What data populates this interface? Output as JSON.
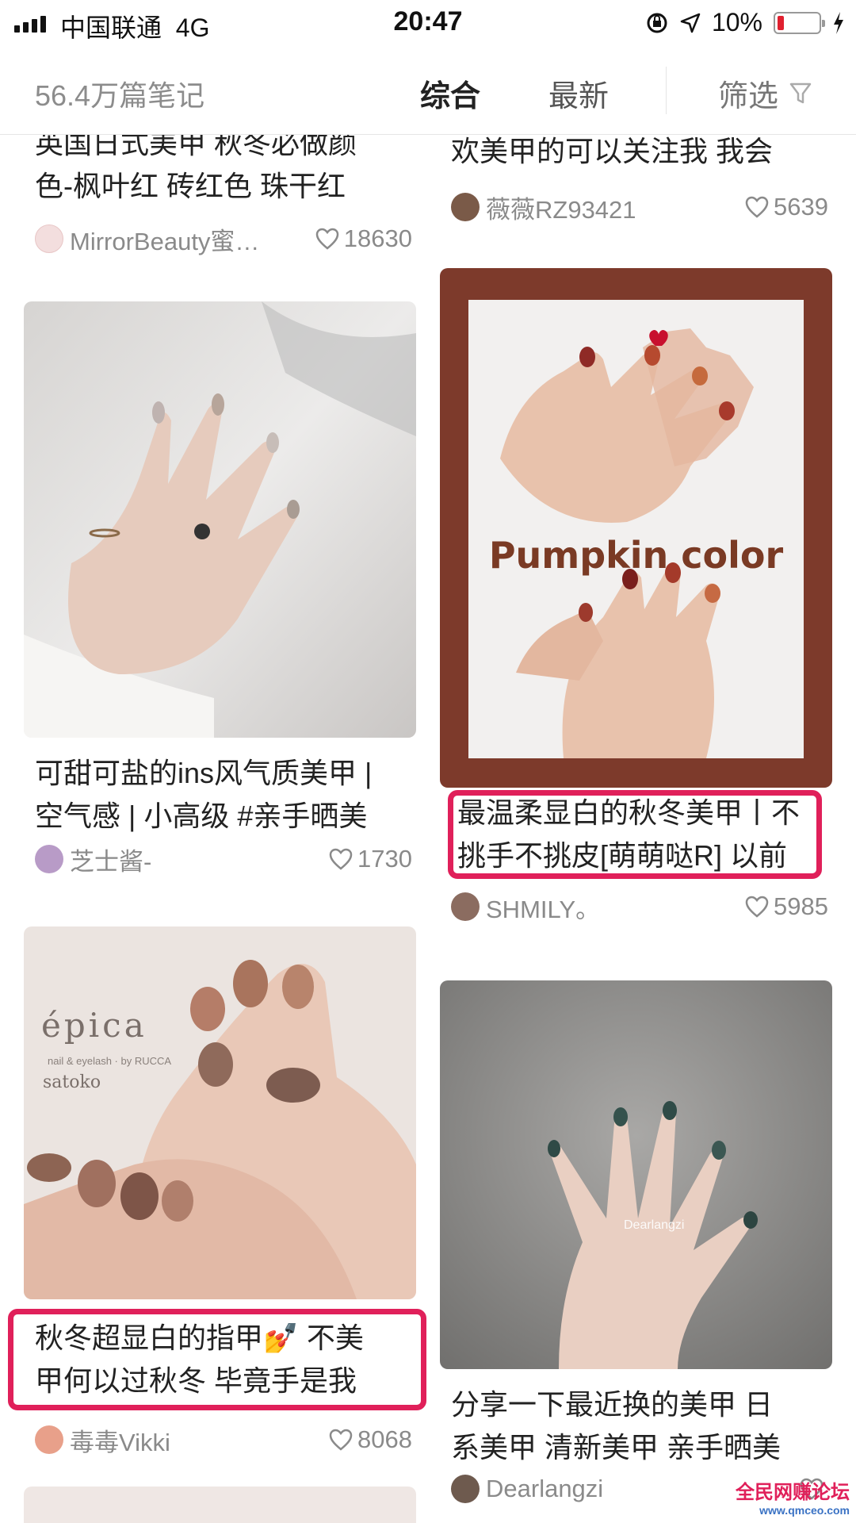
{
  "status_bar": {
    "carrier": "中国联通",
    "network": "4G",
    "time": "20:47",
    "battery": "10%"
  },
  "header": {
    "notes_count": "56.4万篇笔记",
    "tabs": [
      {
        "label": "综合",
        "active": true
      },
      {
        "label": "最新",
        "active": false
      }
    ],
    "filter_label": "筛选"
  },
  "feed": {
    "left": [
      {
        "title_lines": [
          "英国日式美甲 秋冬必做颜",
          "色-枫叶红 砖红色 珠干红"
        ],
        "author": "MirrorBeauty蜜…",
        "likes": "18630",
        "image": null
      },
      {
        "title_lines": [
          "可甜可盐的ins风气质美甲 |",
          "空气感 | 小高级 #亲手晒美"
        ],
        "author": "芝士酱-",
        "likes": "1730",
        "image": "hand-with-rings-photo"
      },
      {
        "title_lines": [
          "秋冬超显白的指甲💅 不美",
          "甲何以过秋冬 毕竟手是我"
        ],
        "author": "毒毒Vikki",
        "likes": "8068",
        "image": "epica-nails-photo",
        "image_text": {
          "brand": "épica",
          "sub": "nail & eyelash · by RUCCA",
          "name": "satoko"
        },
        "highlighted": true
      }
    ],
    "right": [
      {
        "title_lines": [
          "欢美甲的可以关注我 我会"
        ],
        "author": "薇薇RZ93421",
        "likes": "5639",
        "image": null
      },
      {
        "title_lines": [
          "最温柔显白的秋冬美甲丨不",
          "挑手不挑皮[萌萌哒R] 以前"
        ],
        "author": "SHMILY。",
        "likes": "5985",
        "image": "pumpkin-color-nails-photo",
        "image_text": {
          "overlay": "Pumpkin color"
        },
        "highlighted": true
      },
      {
        "title_lines": [
          "分享一下最近换的美甲 日",
          "系美甲 清新美甲 亲手晒美"
        ],
        "author": "Dearlangzi",
        "likes": "",
        "image": "dark-green-nails-photo",
        "image_text": {
          "watermark": "Dearlangzi"
        }
      }
    ]
  },
  "watermark": {
    "text": "全民网赚论坛",
    "sub": "www.qmceo.com"
  },
  "colors": {
    "highlight": "#e0205a",
    "muted": "#8a8a8a",
    "text": "#222222"
  }
}
